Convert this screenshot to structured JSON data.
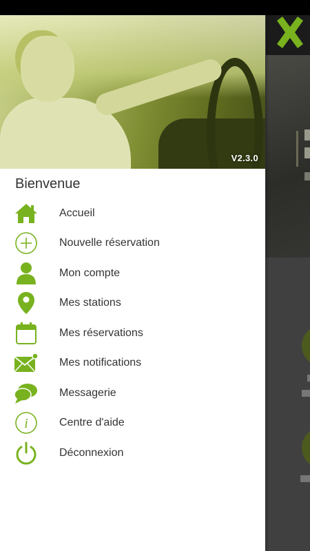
{
  "app": {
    "version": "V2.3.0",
    "welcome": "Bienvenue",
    "accent_color": "#78b21e"
  },
  "menu": {
    "items": [
      {
        "label": "Accueil",
        "icon": "home-icon"
      },
      {
        "label": "Nouvelle réservation",
        "icon": "plus-circle-icon"
      },
      {
        "label": "Mon compte",
        "icon": "user-icon"
      },
      {
        "label": "Mes stations",
        "icon": "map-pin-icon"
      },
      {
        "label": "Mes réservations",
        "icon": "calendar-icon"
      },
      {
        "label": "Mes notifications",
        "icon": "envelope-icon"
      },
      {
        "label": "Messagerie",
        "icon": "chat-icon"
      },
      {
        "label": "Centre d'aide",
        "icon": "info-icon"
      },
      {
        "label": "Déconnexion",
        "icon": "power-icon"
      }
    ]
  },
  "background_app": {
    "close_icon": "close-icon"
  }
}
